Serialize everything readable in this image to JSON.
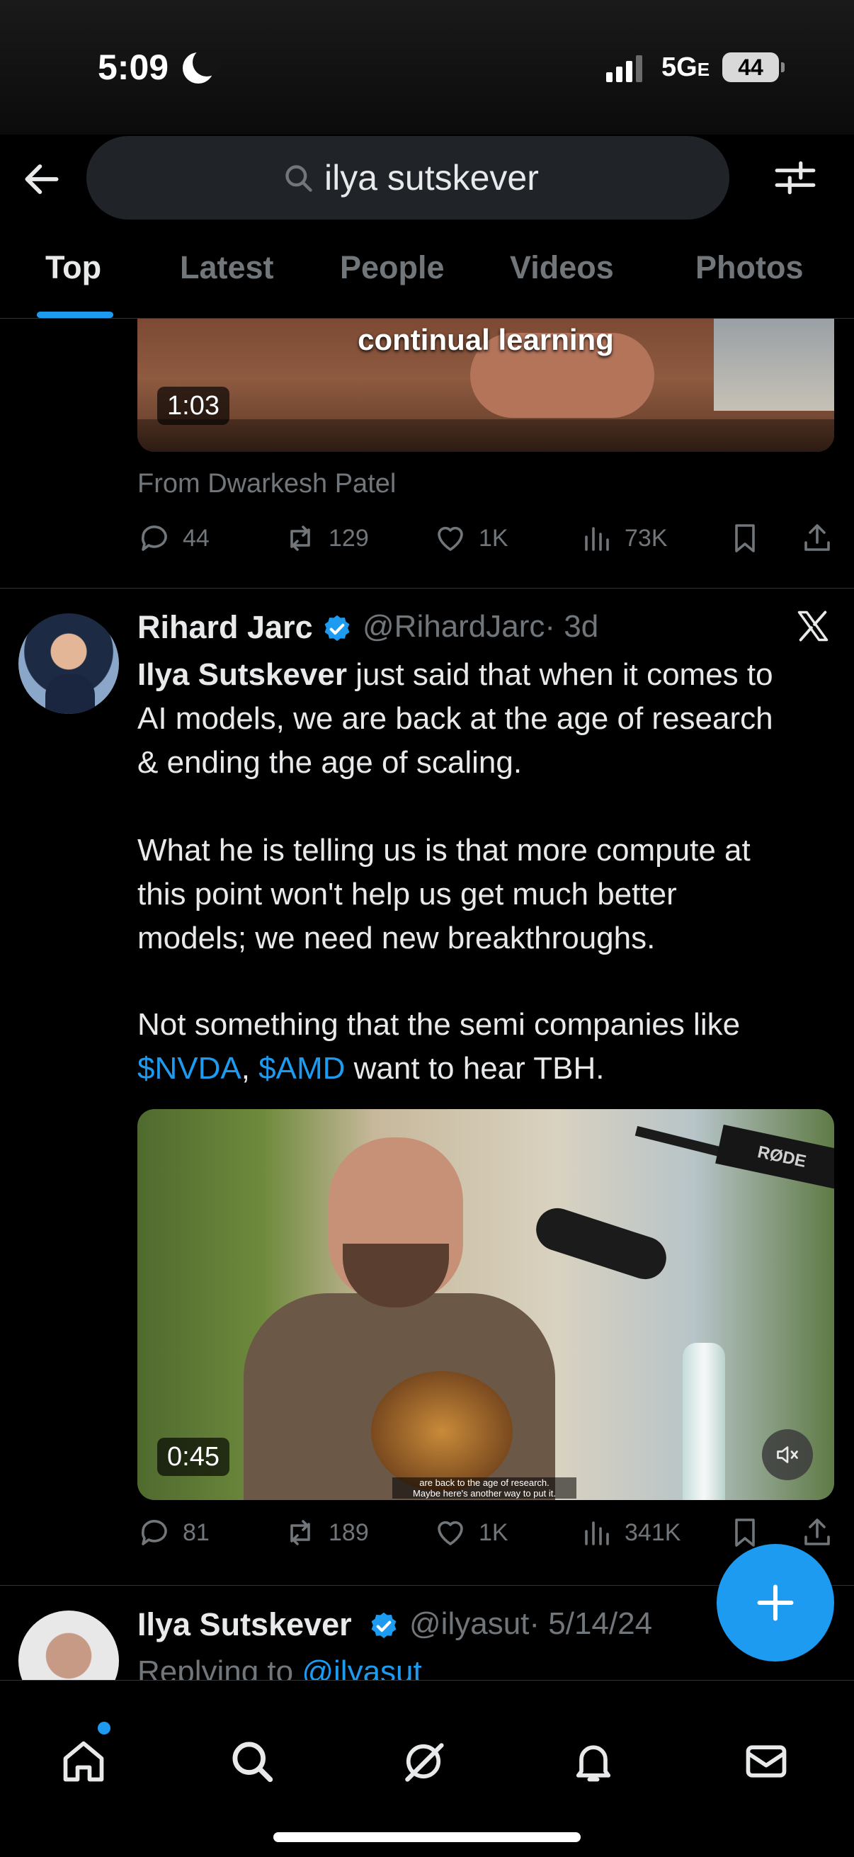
{
  "status_bar": {
    "time": "5:09",
    "network": "5G",
    "network_suffix": "E",
    "battery": "44"
  },
  "search": {
    "query": "ilya sutskever"
  },
  "tabs": [
    {
      "label": "Top",
      "active": true
    },
    {
      "label": "Latest"
    },
    {
      "label": "People"
    },
    {
      "label": "Videos"
    },
    {
      "label": "Photos"
    }
  ],
  "tweet1": {
    "video_caption": "continual learning",
    "duration": "1:03",
    "source": "From Dwarkesh Patel",
    "stats": {
      "replies": "44",
      "reposts": "129",
      "likes": "1K",
      "views": "73K"
    }
  },
  "tweet2": {
    "author_name": "Rihard Jarc",
    "handle": "@RihardJarc",
    "time": "· 3d",
    "lines": {
      "l1_bold": "Ilya Sutskever",
      "l1_rest": " just said that when it comes to",
      "l2": "AI models, we are back at the age of research",
      "l3": "& ending the age of scaling.",
      "l4": "What he is telling us is that more compute at",
      "l5": "this point won't help us get much better",
      "l6": "models; we need new breakthroughs.",
      "l7": "Not something that the semi companies like",
      "cashtag1": "$NVDA",
      "sep": ", ",
      "cashtag2": "$AMD",
      "l8_rest": " want to hear TBH."
    },
    "video": {
      "duration": "0:45",
      "brand": "RØDE",
      "subtitle_1": "are back to the age of research.",
      "subtitle_2": "Maybe here's another way to put it."
    },
    "stats": {
      "replies": "81",
      "reposts": "189",
      "likes": "1K",
      "views": "341K"
    }
  },
  "tweet3": {
    "author_name": "Ilya Sutskever",
    "handle": "@ilyasut",
    "time": "· 5/14/24",
    "reply_prefix": "Replying to ",
    "reply_to": "@ilyasut"
  },
  "colors": {
    "accent": "#1d9bf0",
    "muted": "#71767b",
    "text": "#e7e9ea",
    "background": "#000000"
  },
  "icons": [
    "back-arrow-icon",
    "search-icon",
    "filter-icon",
    "reply-icon",
    "repost-icon",
    "like-icon",
    "views-icon",
    "bookmark-icon",
    "share-icon",
    "x-logo-icon",
    "verified-icon",
    "mute-icon",
    "plus-icon",
    "home-icon",
    "explore-icon",
    "grok-icon",
    "bell-icon",
    "mail-icon"
  ]
}
